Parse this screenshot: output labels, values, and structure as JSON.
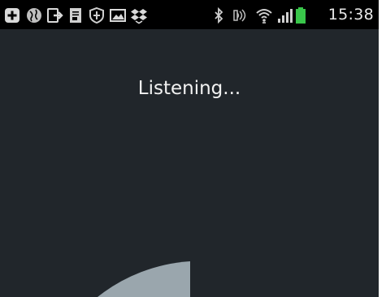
{
  "status_bar": {
    "time": "15:38",
    "left_icons": [
      "add-box-icon",
      "globe-icon",
      "file-export-icon",
      "document-icon",
      "shield-icon",
      "image-icon",
      "dropbox-icon"
    ],
    "right_icons": [
      "bluetooth-icon",
      "nfc-icon",
      "wifi-icon",
      "signal-icon",
      "battery-icon"
    ],
    "battery_color": "#39c64a"
  },
  "voice": {
    "status_text": "Listening..."
  },
  "colors": {
    "background": "#21262b",
    "status_bar": "#000000",
    "mic_circle": "#9aa6ad"
  }
}
